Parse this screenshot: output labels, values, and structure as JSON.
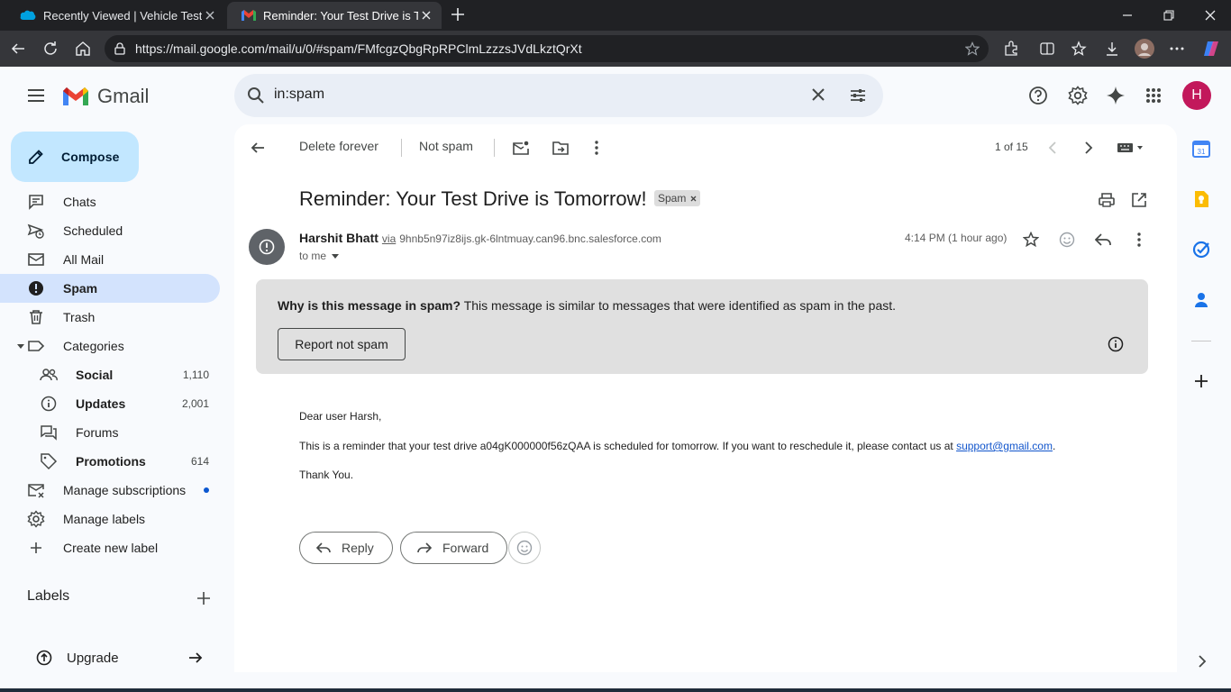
{
  "browser": {
    "tabs": [
      {
        "title": "Recently Viewed | Vehicle Test Dri",
        "icon": "salesforce-cloud-icon",
        "active": false
      },
      {
        "title": "Reminder: Your Test Drive is Tomo",
        "icon": "gmail-icon",
        "active": true
      }
    ],
    "url": "https://mail.google.com/mail/u/0/#spam/FMfcgzQbgRpRPClmLzzzsJVdLkztQrXt"
  },
  "gmail": {
    "product_name": "Gmail",
    "search_query": "in:spam",
    "avatar_letter": "H",
    "compose_label": "Compose"
  },
  "sidebar": {
    "items": [
      {
        "label": "Chats",
        "icon": "chat-icon"
      },
      {
        "label": "Scheduled",
        "icon": "scheduled-send-icon"
      },
      {
        "label": "All Mail",
        "icon": "all-mail-icon"
      },
      {
        "label": "Spam",
        "icon": "report-icon",
        "active": true
      },
      {
        "label": "Trash",
        "icon": "trash-icon"
      },
      {
        "label": "Categories",
        "icon": "label-icon"
      }
    ],
    "categories": [
      {
        "label": "Social",
        "count": "1,110",
        "icon": "people-icon"
      },
      {
        "label": "Updates",
        "count": "2,001",
        "icon": "info-icon"
      },
      {
        "label": "Forums",
        "count": "",
        "icon": "forum-icon"
      },
      {
        "label": "Promotions",
        "count": "614",
        "icon": "tag-icon"
      }
    ],
    "manage_subscriptions": "Manage subscriptions",
    "manage_labels": "Manage labels",
    "create_label": "Create new label",
    "labels_heading": "Labels",
    "upgrade_label": "Upgrade"
  },
  "toolbar": {
    "delete_forever": "Delete forever",
    "not_spam": "Not spam",
    "pagination": "1 of 15"
  },
  "message": {
    "subject": "Reminder: Your Test Drive is Tomorrow!",
    "label_chip": "Spam",
    "sender_name": "Harshit Bhatt",
    "via_text": "via",
    "sender_domain": "9hnb5n97iz8ijs.gk-6lntmuay.can96.bnc.salesforce.com",
    "recipient": "to me",
    "time": "4:14 PM (1 hour ago)",
    "spam_banner": {
      "question": "Why is this message in spam?",
      "explanation": "This message is similar to messages that were identified as spam in the past.",
      "button": "Report not spam"
    },
    "greeting": "Dear user Harsh,",
    "body_before_link": "This is a reminder that your test drive a04gK000000f56zQAA is scheduled for tomorrow. If you want to reschedule it, please contact us at ",
    "link": "support@gmail.com",
    "body_after_link": ".",
    "closing": "Thank You.",
    "reply_label": "Reply",
    "forward_label": "Forward"
  },
  "colors": {
    "compose_bg": "#c2e7ff",
    "active_nav_bg": "#d3e3fd",
    "spam_banner_bg": "#e0e0e0",
    "avatar_bg": "#c2185b",
    "link": "#1155cc"
  }
}
